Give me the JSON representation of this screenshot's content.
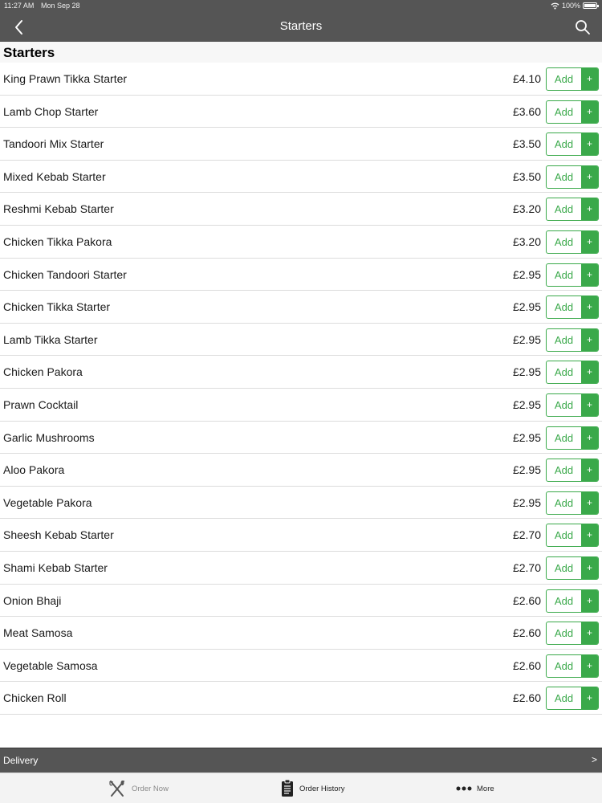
{
  "status_bar": {
    "time": "11:27 AM",
    "date": "Mon Sep 28",
    "battery": "100%"
  },
  "nav": {
    "title": "Starters",
    "back_icon": "chevron-left-icon",
    "search_icon": "search-icon"
  },
  "section": {
    "title": "Starters"
  },
  "add_button": {
    "label": "Add",
    "plus": "+"
  },
  "items": [
    {
      "name": "King Prawn Tikka Starter",
      "price": "£4.10"
    },
    {
      "name": "Lamb Chop Starter",
      "price": "£3.60"
    },
    {
      "name": "Tandoori Mix Starter",
      "price": "£3.50"
    },
    {
      "name": "Mixed Kebab Starter",
      "price": "£3.50"
    },
    {
      "name": "Reshmi Kebab Starter",
      "price": "£3.20"
    },
    {
      "name": "Chicken Tikka Pakora",
      "price": "£3.20"
    },
    {
      "name": "Chicken Tandoori Starter",
      "price": "£2.95"
    },
    {
      "name": "Chicken Tikka Starter",
      "price": "£2.95"
    },
    {
      "name": "Lamb Tikka Starter",
      "price": "£2.95"
    },
    {
      "name": "Chicken Pakora",
      "price": "£2.95"
    },
    {
      "name": "Prawn Cocktail",
      "price": "£2.95"
    },
    {
      "name": "Garlic Mushrooms",
      "price": "£2.95"
    },
    {
      "name": "Aloo Pakora",
      "price": "£2.95"
    },
    {
      "name": "Vegetable Pakora",
      "price": "£2.95"
    },
    {
      "name": "Sheesh Kebab Starter",
      "price": "£2.70"
    },
    {
      "name": "Shami Kebab Starter",
      "price": "£2.70"
    },
    {
      "name": "Onion Bhaji",
      "price": "£2.60"
    },
    {
      "name": "Meat Samosa",
      "price": "£2.60"
    },
    {
      "name": "Vegetable Samosa",
      "price": "£2.60"
    },
    {
      "name": "Chicken Roll",
      "price": "£2.60"
    }
  ],
  "delivery_bar": {
    "label": "Delivery",
    "chevron": ">"
  },
  "tabs": [
    {
      "label": "Order Now",
      "icon": "fork-knife-icon"
    },
    {
      "label": "Order History",
      "icon": "clipboard-icon"
    },
    {
      "label": "More",
      "icon": "more-dots-icon"
    }
  ],
  "colors": {
    "bar": "#555555",
    "accent": "#3aa94a"
  }
}
